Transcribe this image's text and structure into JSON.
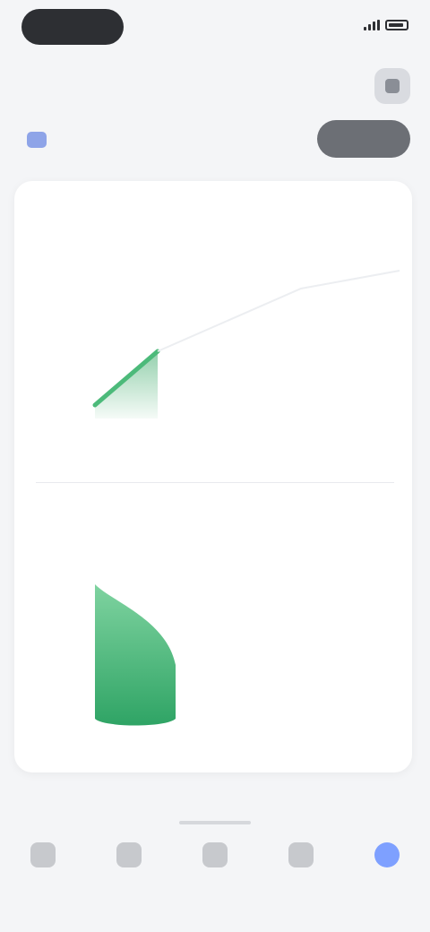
{
  "status_bar": {
    "time": ""
  },
  "header": {
    "title": "",
    "filter_label": "",
    "action_label": ""
  },
  "card": {
    "section_title": "",
    "section_change": "",
    "balance_label": "",
    "side_caption": "",
    "side_value": ""
  },
  "tabs": [
    {
      "label": "",
      "icon": "home-icon"
    },
    {
      "label": "",
      "icon": "chart-icon"
    },
    {
      "label": "",
      "icon": "wallet-icon"
    },
    {
      "label": "",
      "icon": "list-icon"
    },
    {
      "label": "",
      "icon": "profile-icon"
    }
  ],
  "active_tab": 4,
  "colors": {
    "accent_green": "#3daa6a",
    "accent_blue": "#7ea0ff",
    "dark": "#2d2f33"
  }
}
